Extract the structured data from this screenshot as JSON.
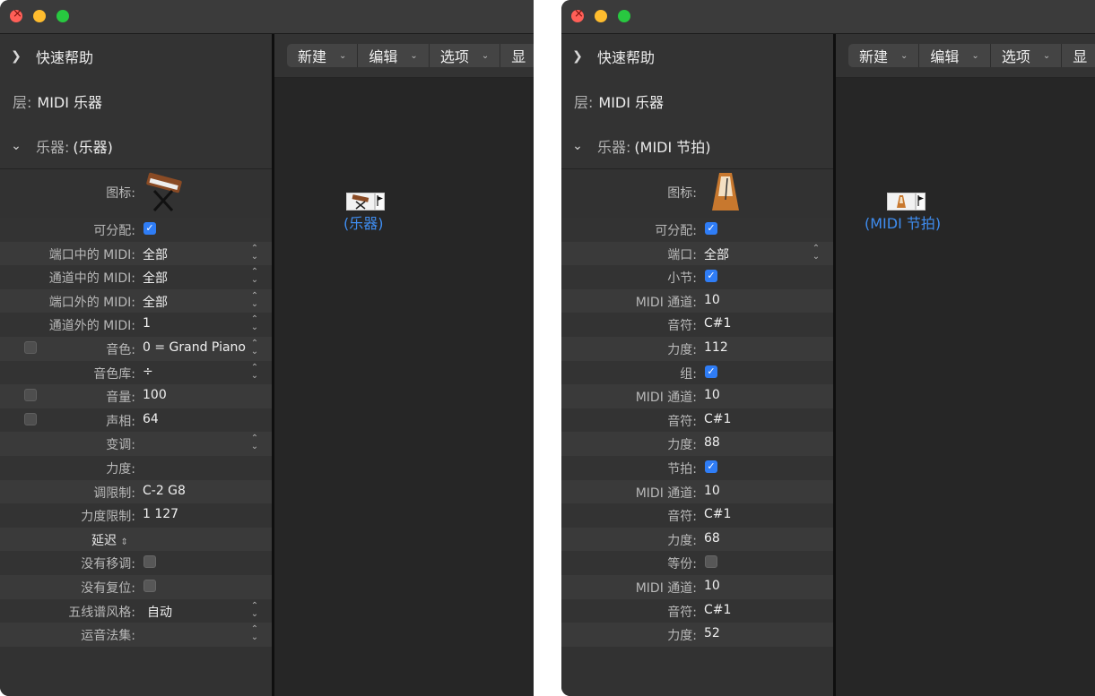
{
  "left": {
    "quick_help": "快速帮助",
    "layer_label": "层:",
    "layer_value": "MIDI 乐器",
    "instrument_label": "乐器:",
    "instrument_value": "(乐器)",
    "toolbar": [
      "新建",
      "编辑",
      "选项",
      "显"
    ],
    "canvas_object_label": "(乐器)",
    "rows": {
      "icon": "图标:",
      "assignable": "可分配:",
      "midi_in_port": "端口中的 MIDI:",
      "midi_in_port_val": "全部",
      "midi_in_chan": "通道中的 MIDI:",
      "midi_in_chan_val": "全部",
      "midi_out_port": "端口外的 MIDI:",
      "midi_out_port_val": "全部",
      "midi_out_chan": "通道外的 MIDI:",
      "midi_out_chan_val": "1",
      "program": "音色:",
      "program_val": "0 = Grand Piano",
      "bank": "音色库:",
      "bank_val": "÷",
      "volume": "音量:",
      "volume_val": "100",
      "pan": "声相:",
      "pan_val": "64",
      "transpose": "变调:",
      "velocity": "力度:",
      "key_limit": "调限制:",
      "key_limit_val": "C-2  G8",
      "vel_limit": "力度限制:",
      "vel_limit_val": "1  127",
      "delay": "延迟",
      "no_transpose": "没有移调:",
      "no_reset": "没有复位:",
      "staff_style": "五线谱风格:",
      "staff_style_val": "自动",
      "articulation": "运音法集:"
    }
  },
  "right": {
    "quick_help": "快速帮助",
    "layer_label": "层:",
    "layer_value": "MIDI 乐器",
    "instrument_label": "乐器:",
    "instrument_value": "(MIDI 节拍)",
    "toolbar": [
      "新建",
      "编辑",
      "选项",
      "显"
    ],
    "canvas_object_label": "(MIDI 节拍)",
    "rows": {
      "icon": "图标:",
      "assignable": "可分配:",
      "port": "端口:",
      "port_val": "全部",
      "bar": "小节:",
      "bar_chan": "MIDI 通道:",
      "bar_chan_val": "10",
      "bar_note": "音符:",
      "bar_note_val": "C#1",
      "bar_vel": "力度:",
      "bar_vel_val": "112",
      "group": "组:",
      "group_chan": "MIDI 通道:",
      "group_chan_val": "10",
      "group_note": "音符:",
      "group_note_val": "C#1",
      "group_vel": "力度:",
      "group_vel_val": "88",
      "beat": "节拍:",
      "beat_chan": "MIDI 通道:",
      "beat_chan_val": "10",
      "beat_note": "音符:",
      "beat_note_val": "C#1",
      "beat_vel": "力度:",
      "beat_vel_val": "68",
      "div": "等份:",
      "div_chan": "MIDI 通道:",
      "div_chan_val": "10",
      "div_note": "音符:",
      "div_note_val": "C#1",
      "div_vel": "力度:",
      "div_vel_val": "52"
    }
  },
  "colors": {
    "accent": "#2f7df6",
    "object_label": "#3f8df0",
    "panel": "#323232",
    "canvas": "#262626"
  }
}
